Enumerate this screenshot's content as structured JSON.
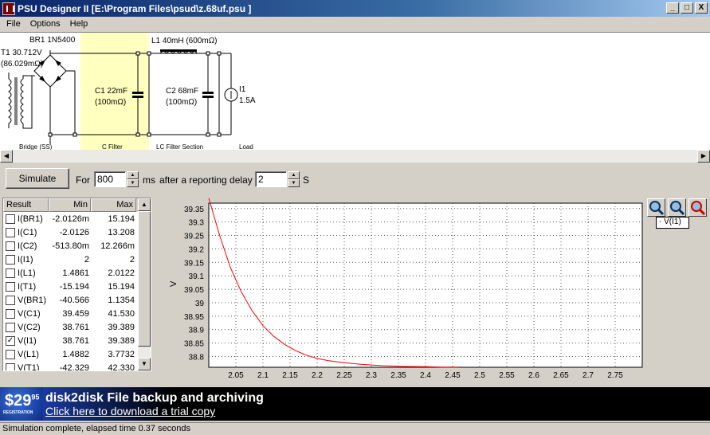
{
  "window": {
    "title": "PSU Designer II  [E:\\Program Files\\psud\\z.68uf.psu ]",
    "controls": {
      "minimize": "_",
      "maximize": "□",
      "close": "X"
    }
  },
  "menu": [
    "File",
    "Options",
    "Help"
  ],
  "schematic": {
    "bridge_label": "BR1 1N5400",
    "transformer_label_1": "T1 30.712V",
    "transformer_label_2": "(86.029mΩ)",
    "c1_label_1": "C1 22mF",
    "c1_label_2": "(100mΩ)",
    "l1_label": "L1 40mH (600mΩ)",
    "c2_label_1": "C2 68mF",
    "c2_label_2": "(100mΩ)",
    "i1_label_1": "I1",
    "i1_label_2": "1.5A",
    "section_labels": [
      "Bridge (SS)",
      "C Filter",
      "LC Filter Section",
      "Load"
    ]
  },
  "simulation": {
    "button_label": "Simulate",
    "for_label": "For",
    "duration": "800",
    "ms_label": "ms",
    "delay_label": "after a reporting delay of",
    "delay": "2",
    "s_label": "S"
  },
  "results": {
    "headers": [
      "Result",
      "Min",
      "Max"
    ],
    "rows": [
      {
        "name": "I(BR1)",
        "min": "-2.0126m",
        "max": "15.194",
        "checked": false
      },
      {
        "name": "I(C1)",
        "min": "-2.0126",
        "max": "13.208",
        "checked": false
      },
      {
        "name": "I(C2)",
        "min": "-513.80m",
        "max": "12.266m",
        "checked": false
      },
      {
        "name": "I(I1)",
        "min": "2",
        "max": "2",
        "checked": false
      },
      {
        "name": "I(L1)",
        "min": "1.4861",
        "max": "2.0122",
        "checked": false
      },
      {
        "name": "I(T1)",
        "min": "-15.194",
        "max": "15.194",
        "checked": false
      },
      {
        "name": "V(BR1)",
        "min": "-40.566",
        "max": "1.1354",
        "checked": false
      },
      {
        "name": "V(C1)",
        "min": "39.459",
        "max": "41.530",
        "checked": false
      },
      {
        "name": "V(C2)",
        "min": "38.761",
        "max": "39.389",
        "checked": false
      },
      {
        "name": "V(I1)",
        "min": "38.761",
        "max": "39.389",
        "checked": true
      },
      {
        "name": "V(L1)",
        "min": "1.4882",
        "max": "3.7732",
        "checked": false
      },
      {
        "name": "V(T1)",
        "min": "-42.329",
        "max": "42.330",
        "checked": false
      }
    ]
  },
  "chart_data": {
    "type": "line",
    "ylabel": "V",
    "xlabel": "",
    "y_ticks": [
      "39.35",
      "39.3",
      "39.25",
      "39.2",
      "39.15",
      "39.1",
      "39.05",
      "39",
      "38.95",
      "38.9",
      "38.85",
      "38.8"
    ],
    "x_ticks": [
      "2.05",
      "2.1",
      "2.15",
      "2.2",
      "2.25",
      "2.3",
      "2.35",
      "2.4",
      "2.45",
      "2.5",
      "2.55",
      "2.6",
      "2.65",
      "2.7",
      "2.75"
    ],
    "xlim": [
      2.0,
      2.8
    ],
    "ylim": [
      38.76,
      39.37
    ],
    "grid": true,
    "legend": "top-right",
    "series": [
      {
        "name": "V(I1)",
        "color": "#ff0000",
        "x": [
          2.0,
          2.02,
          2.04,
          2.06,
          2.08,
          2.1,
          2.12,
          2.14,
          2.16,
          2.18,
          2.2,
          2.22,
          2.25,
          2.28,
          2.32,
          2.36,
          2.4,
          2.43,
          2.46
        ],
        "y": [
          39.389,
          39.25,
          39.13,
          39.04,
          38.97,
          38.915,
          38.875,
          38.845,
          38.822,
          38.805,
          38.793,
          38.785,
          38.777,
          38.771,
          38.766,
          38.763,
          38.762,
          38.761,
          38.761
        ]
      }
    ]
  },
  "banner": {
    "price": "$29",
    "price_cents": "95",
    "price_note": "REGISTRATION",
    "headline": "disk2disk File backup and archiving",
    "link": "Click here to download a trial copy"
  },
  "status": "Simulation complete, elapsed time 0.37 seconds",
  "colors": {
    "title_bar": "#0a246a",
    "c_filter_highlight": "#ffffc0",
    "trace": "#ff0000"
  }
}
